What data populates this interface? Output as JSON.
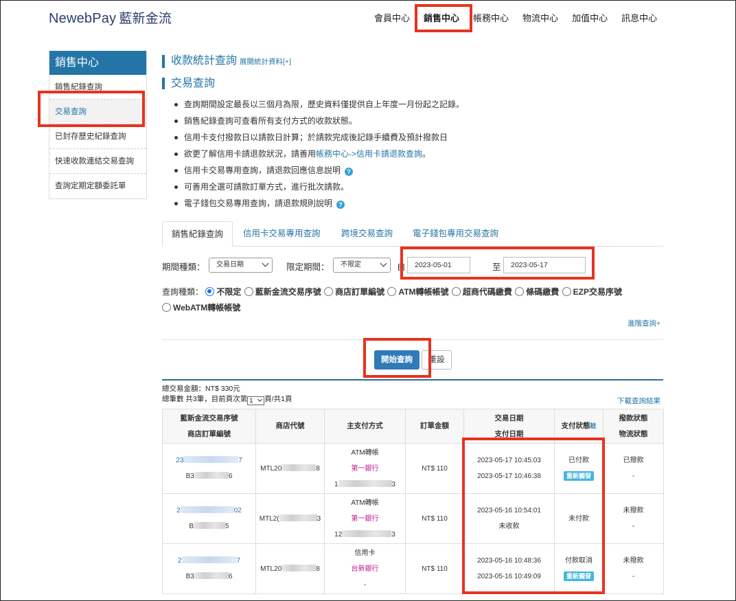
{
  "brand": {
    "en": "NewebPay",
    "cn": "藍新金流"
  },
  "topnav": [
    "會員中心",
    "銷售中心",
    "帳務中心",
    "物流中心",
    "加值中心",
    "訊息中心"
  ],
  "sidebar": {
    "title": "銷售中心",
    "items": [
      "銷售紀錄查詢",
      "交易查詢",
      "已封存歷史紀錄查詢",
      "快速收款連結交易查詢",
      "查詢定期定額委託單"
    ],
    "active_index": 1
  },
  "section1": {
    "title": "收款統計查詢",
    "link": "展開統計資料[+]"
  },
  "section2": {
    "title": "交易查詢"
  },
  "bullets": {
    "b1": "查詢期間設定最長以三個月為限，歷史資料僅提供自上年度一月份起之記錄。",
    "b2": "銷售紀錄查詢可查看所有支付方式的收款狀態。",
    "b3": "信用卡支付撥款日以請款日計算；於請款完成後記錄手續費及預計撥款日",
    "b4_pre": "欲更了解信用卡請退款狀況，請善用",
    "b4_link": "帳務中心->信用卡請退款查詢",
    "b4_post": "。",
    "b5": "信用卡交易專用查詢，請退款回應信息說明",
    "b6": "可善用全選可請款訂單方式，進行批次請款。",
    "b7": "電子錢包交易專用查詢，請退款規則說明"
  },
  "tabs": [
    "銷售紀錄查詢",
    "信用卡交易專用查詢",
    "跨境交易查詢",
    "電子錢包專用交易查詢"
  ],
  "filter": {
    "period_type_label": "期間種類：",
    "period_type_value": "交易日期",
    "limit_label": "限定期間：",
    "limit_value": "不限定",
    "from_label": "自",
    "date_from": "2023-05-01",
    "to_label": "至",
    "date_to": "2023-05-17",
    "query_type_label": "查詢種類：",
    "query_types": [
      "不限定",
      "藍新金流交易序號",
      "商店訂單編號",
      "ATM轉帳帳號",
      "超商代碼繳費",
      "條碼繳費",
      "EZP交易序號",
      "WebATM轉帳帳號"
    ],
    "advanced": "進階查詢+"
  },
  "buttons": {
    "search": "開始查詢",
    "reset": "重設"
  },
  "summary": {
    "total_amount": "總交易金額：NT$ 330元",
    "count_pre": "總筆數 共3筆，目前頁次第",
    "page": "1",
    "count_post": "頁/共1頁",
    "download": "下載查詢結果"
  },
  "table": {
    "headers": {
      "h1a": "藍新金流交易序號",
      "h1b": "商店訂單編號",
      "h2": "商店代號",
      "h3": "主支付方式",
      "h4": "訂單金額",
      "h5a": "交易日期",
      "h5b": "支付日期",
      "h6": "支付狀態",
      "h6note": "註",
      "h7a": "撥款狀態",
      "h7b": "物流狀態"
    },
    "rows": [
      {
        "tx_pre": "23",
        "tx_post": "7",
        "order_pre": "B3",
        "order_post": "6",
        "store_pre": "MTL20",
        "store_post": "8",
        "method": "ATM轉帳",
        "bank": "第一銀行",
        "acct_pre": "1",
        "acct_post": "3",
        "amount": "NT$ 110",
        "tx_date": "2023-05-17 10:45:03",
        "pay_date": "2023-05-17 10:46:38",
        "pay_status": "已付款",
        "resend": "重新觸發",
        "payout": "已撥款",
        "logistics": "-"
      },
      {
        "tx_pre": "2",
        "tx_post": "02",
        "order_pre": "B",
        "order_post": "5",
        "store_pre": "MTL2(",
        "store_post": "3",
        "method": "ATM轉帳",
        "bank": "第一銀行",
        "acct_pre": "12",
        "acct_post": "3",
        "amount": "NT$ 110",
        "tx_date": "2023-05-16 10:54:01",
        "pay_date": "未收款",
        "pay_status": "未付款",
        "resend": "",
        "payout": "未撥款",
        "logistics": "-"
      },
      {
        "tx_pre": "2",
        "tx_post": "7",
        "order_pre": "B3",
        "order_post": "6",
        "store_pre": "MTL20",
        "store_post": "8",
        "method": "信用卡",
        "bank": "台新銀行",
        "acct_pre": "-",
        "acct_post": "",
        "amount": "NT$ 110",
        "tx_date": "2023-05-16 10:48:36",
        "pay_date": "2023-05-16 10:49:09",
        "pay_status": "付款取消",
        "resend": "重新觸發",
        "payout": "未撥款",
        "logistics": "-"
      }
    ]
  },
  "colors": {
    "accent": "#2475a7",
    "highlight": "#e8321f",
    "bank": "#c0188c",
    "badge": "#45b6dd"
  }
}
